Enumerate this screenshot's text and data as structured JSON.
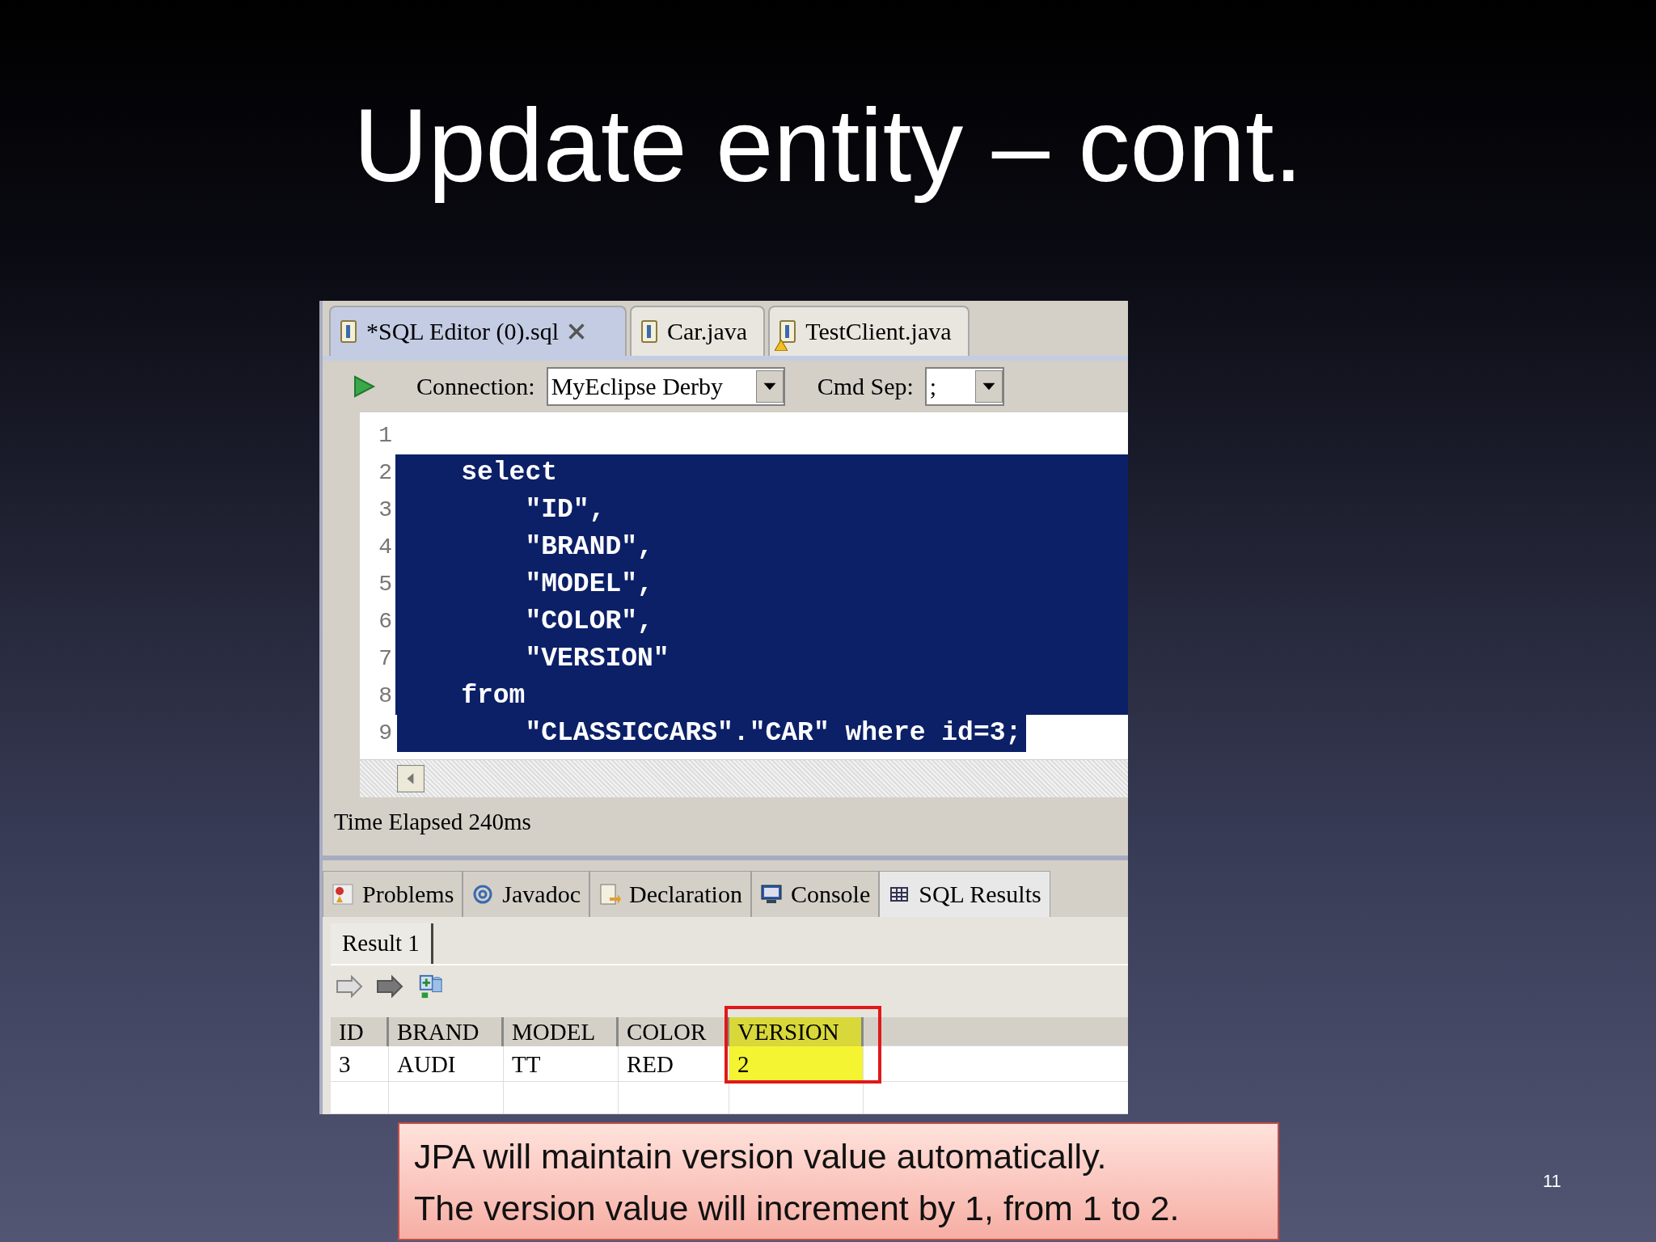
{
  "slide": {
    "title": "Update entity – cont.",
    "page_number": "11"
  },
  "editor": {
    "tabs": [
      {
        "label": "*SQL Editor (0).sql",
        "selected": true,
        "closable": true
      },
      {
        "label": "Car.java",
        "selected": false
      },
      {
        "label": "TestClient.java",
        "selected": false,
        "warning": true
      }
    ],
    "connection_label": "Connection:",
    "connection": "MyEclipse Derby",
    "cmd_sep_label": "Cmd Sep:",
    "cmd_sep": ";",
    "lines": [
      {
        "number": "1"
      },
      {
        "number": "2",
        "text": "    select",
        "selected": true
      },
      {
        "number": "3",
        "text": "        \"ID\",",
        "selected": true
      },
      {
        "number": "4",
        "text": "        \"BRAND\",",
        "selected": true
      },
      {
        "number": "5",
        "text": "        \"MODEL\",",
        "selected": true
      },
      {
        "number": "6",
        "text": "        \"COLOR\",",
        "selected": true
      },
      {
        "number": "7",
        "text": "        \"VERSION\"",
        "selected": true
      },
      {
        "number": "8",
        "text": "    from",
        "selected": true
      },
      {
        "number": "9",
        "text": "        \"CLASSICCARS\".\"CAR\" where id=3;",
        "selected": true
      }
    ],
    "status": "Time Elapsed 240ms"
  },
  "results": {
    "tabs": [
      {
        "label": "Problems",
        "kind": "problems",
        "selected": false
      },
      {
        "label": "Javadoc",
        "kind": "javadoc",
        "selected": false
      },
      {
        "label": "Declaration",
        "kind": "declaration",
        "selected": false
      },
      {
        "label": "Console",
        "kind": "console",
        "selected": false
      },
      {
        "label": "SQL Results",
        "kind": "grid",
        "selected": true
      }
    ],
    "result_tabs": [
      {
        "label": "Result 1",
        "selected": true
      }
    ],
    "columns": [
      {
        "label": "ID",
        "highlighted": false
      },
      {
        "label": "BRAND",
        "highlighted": false
      },
      {
        "label": "MODEL",
        "highlighted": false
      },
      {
        "label": "COLOR",
        "highlighted": false
      },
      {
        "label": "VERSION",
        "highlighted": true
      }
    ],
    "rows": [
      [
        "3",
        "AUDI",
        "TT",
        "RED",
        "2"
      ]
    ]
  },
  "note": {
    "lines": [
      "JPA will maintain version value automatically.",
      "The version value will increment by 1, from 1 to 2."
    ]
  }
}
